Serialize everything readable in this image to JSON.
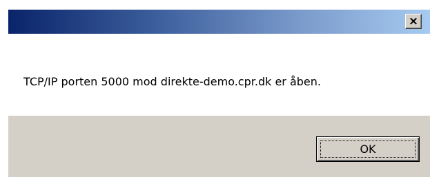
{
  "dialog": {
    "title": "",
    "message": "TCP/IP porten 5000 mod direkte-demo.cpr.dk er åben.",
    "close_glyph": "×",
    "close_icon": "close-icon",
    "ok_label": "OK"
  },
  "colors": {
    "titlebar_start": "#0a246a",
    "titlebar_end": "#a6caf0",
    "footer_bg": "#d4d0c8",
    "content_bg": "#ffffff"
  }
}
